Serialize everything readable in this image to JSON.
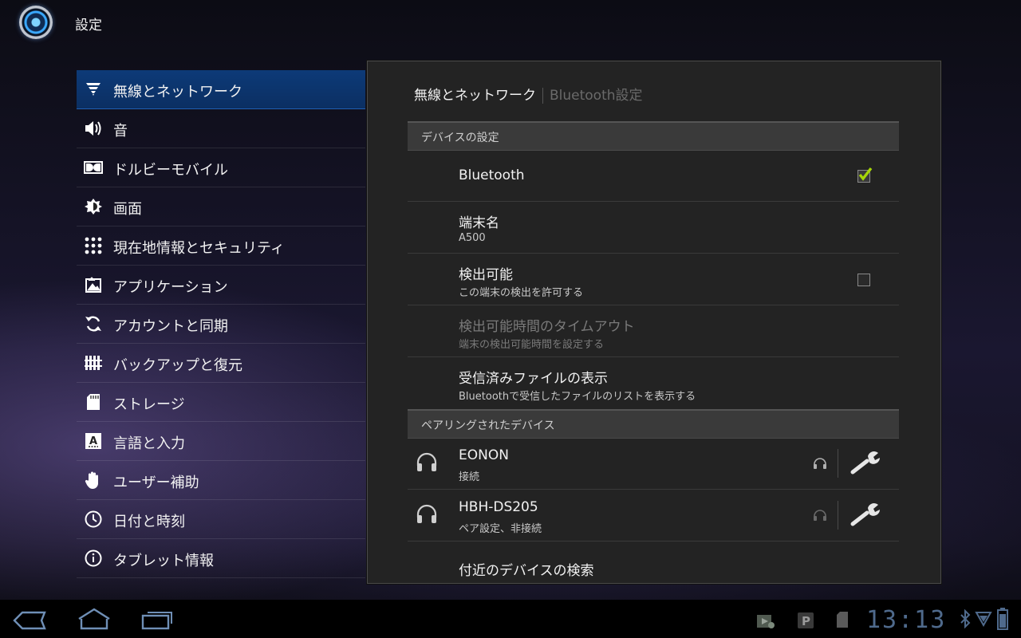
{
  "app": {
    "title": "設定",
    "icon": "settings-app-icon"
  },
  "sidebar": {
    "items": [
      {
        "label": "無線とネットワーク",
        "icon": "wifi-icon",
        "selected": true
      },
      {
        "label": "音",
        "icon": "speaker-icon"
      },
      {
        "label": "ドルビーモバイル",
        "icon": "dolby-icon"
      },
      {
        "label": "画面",
        "icon": "brightness-icon"
      },
      {
        "label": "現在地情報とセキュリティ",
        "icon": "location-grid-icon"
      },
      {
        "label": "アプリケーション",
        "icon": "applications-icon"
      },
      {
        "label": "アカウントと同期",
        "icon": "sync-icon"
      },
      {
        "label": "バックアップと復元",
        "icon": "backup-icon"
      },
      {
        "label": "ストレージ",
        "icon": "sd-card-icon"
      },
      {
        "label": "言語と入力",
        "icon": "language-icon"
      },
      {
        "label": "ユーザー補助",
        "icon": "hand-icon"
      },
      {
        "label": "日付と時刻",
        "icon": "clock-icon"
      },
      {
        "label": "タブレット情報",
        "icon": "info-icon"
      }
    ]
  },
  "panel": {
    "breadcrumb": {
      "parent": "無線とネットワーク",
      "current": "Bluetooth設定"
    },
    "device_settings": {
      "header": "デバイスの設定",
      "rows": [
        {
          "title": "Bluetooth",
          "checkbox": true
        },
        {
          "title": "端末名",
          "subtitle": "A500"
        },
        {
          "title": "検出可能",
          "subtitle": "この端末の検出を許可する",
          "checkbox": false
        },
        {
          "title": "検出可能時間のタイムアウト",
          "subtitle": "端末の検出可能時間を設定する",
          "disabled": true
        },
        {
          "title": "受信済みファイルの表示",
          "subtitle": "Bluetoothで受信したファイルのリストを表示する"
        }
      ]
    },
    "paired": {
      "header": "ペアリングされたデバイス",
      "devices": [
        {
          "name": "EONON",
          "status": "接続"
        },
        {
          "name": "HBH-DS205",
          "status": "ペア設定、非接続"
        }
      ],
      "search_label": "付近のデバイスの検索"
    }
  },
  "systembar": {
    "time": "13:13",
    "accent": "#4f6a8c",
    "nav": [
      "back-icon",
      "home-icon",
      "recent-apps-icon"
    ],
    "status_icons": [
      "play-store-icon",
      "parking-icon",
      "sd-card-icon",
      "bluetooth-icon",
      "signal-icon",
      "battery-icon"
    ]
  }
}
